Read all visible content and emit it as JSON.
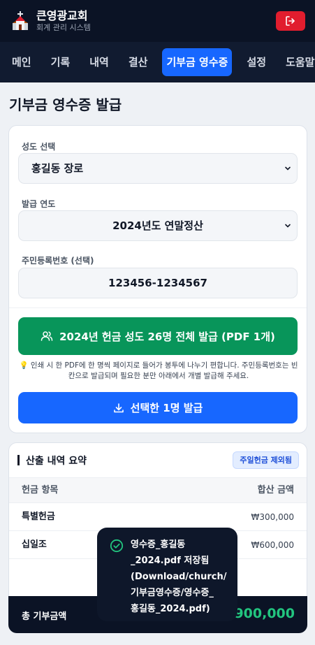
{
  "header": {
    "title": "큰영광교회",
    "subtitle": "회계 관리 시스템"
  },
  "nav": {
    "tabs": [
      "메인",
      "기록",
      "내역",
      "결산",
      "기부금 영수증",
      "설정",
      "도움말"
    ],
    "active": "기부금 영수증"
  },
  "page": {
    "title": "기부금 영수증 발급"
  },
  "form": {
    "member_label": "성도 선택",
    "member_value": "홍길동 장로",
    "year_label": "발급 연도",
    "year_value": "2024년도 연말정산",
    "rrn_label": "주민등록번호 (선택)",
    "rrn_value": "123456-1234567",
    "bulk_button": "2024년 헌금 성도 26명 전체 발급 (PDF 1개)",
    "hint": "💡 인쇄 시 한 PDF에 한 명씩 페이지로 들어가 봉투에 나누기 편합니다. 주민등록번호는 빈칸으로 발급되며 필요한 분만 아래에서 개별 발급해 주세요.",
    "single_button": "선택한 1명 발급"
  },
  "summary": {
    "title": "산출 내역 요약",
    "badge": "주일헌금 제외됨",
    "col_item": "헌금 항목",
    "col_amount": "합산 금액",
    "rows": [
      {
        "item": "특별헌금",
        "amount": "₩300,000"
      },
      {
        "item": "십일조",
        "amount": "₩600,000"
      }
    ],
    "total_label": "총 기부금액",
    "total_value": "₩900,000"
  },
  "toast": {
    "lines": [
      "영수증_홍길동",
      "_2024.pdf 저장됨",
      "(Download/church/",
      "기부금영수증/영수증_",
      "홍길동_2024.pdf)"
    ]
  },
  "colors": {
    "header_bg": "#0b1325",
    "accent_blue": "#1767ff",
    "accent_green": "#08955a",
    "logout_red": "#e11d2e",
    "total_green": "#22c57f"
  },
  "icons": {
    "logo": "church-icon",
    "logout": "logout-icon",
    "select": "chevron-down-icon",
    "bulk": "users-icon",
    "single": "download-icon",
    "toast": "check-circle-icon"
  }
}
